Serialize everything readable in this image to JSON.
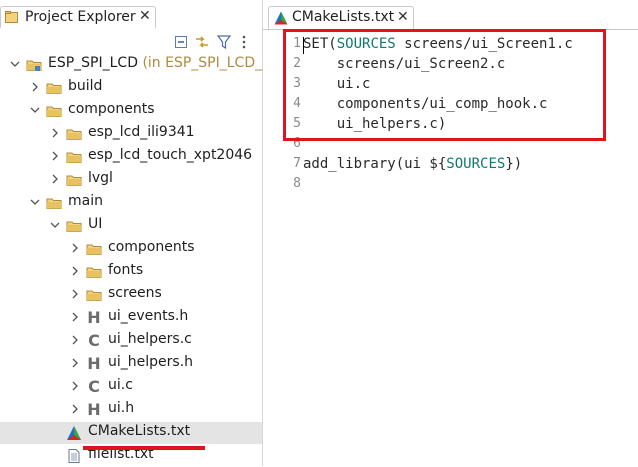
{
  "explorer": {
    "tab_label": "Project Explorer",
    "close_glyph": "✕",
    "toolbar": [
      "collapse-all-icon",
      "link-with-editor-icon",
      "filter-icon",
      "view-menu-icon"
    ],
    "tree": [
      {
        "label": "ESP_SPI_LCD",
        "extra": " (in ESP_SPI_LCD_PA",
        "icon": "project-folder-icon",
        "expanded": true
      },
      {
        "label": "build",
        "icon": "folder-icon",
        "expanded": false
      },
      {
        "label": "components",
        "icon": "folder-icon",
        "expanded": true
      },
      {
        "label": "esp_lcd_ili9341",
        "icon": "folder-icon",
        "expanded": false
      },
      {
        "label": "esp_lcd_touch_xpt2046",
        "icon": "folder-icon",
        "expanded": false
      },
      {
        "label": "lvgl",
        "icon": "folder-icon",
        "expanded": false
      },
      {
        "label": "main",
        "icon": "folder-icon",
        "expanded": true
      },
      {
        "label": "UI",
        "icon": "folder-icon",
        "expanded": true
      },
      {
        "label": "components",
        "icon": "folder-icon",
        "expanded": false
      },
      {
        "label": "fonts",
        "icon": "folder-icon",
        "expanded": false
      },
      {
        "label": "screens",
        "icon": "folder-icon",
        "expanded": false
      },
      {
        "label": "ui_events.h",
        "icon": "h-file-icon",
        "letter": "H"
      },
      {
        "label": "ui_helpers.c",
        "icon": "c-file-icon",
        "letter": "C"
      },
      {
        "label": "ui_helpers.h",
        "icon": "h-file-icon",
        "letter": "H"
      },
      {
        "label": "ui.c",
        "icon": "c-file-icon",
        "letter": "C"
      },
      {
        "label": "ui.h",
        "icon": "h-file-icon",
        "letter": "H"
      },
      {
        "label": "CMakeLists.txt",
        "icon": "cmake-icon",
        "selected": true
      },
      {
        "label": "filelist.txt",
        "icon": "text-file-icon"
      }
    ]
  },
  "editor": {
    "tab_label": "CMakeLists.txt",
    "close_glyph": "✕",
    "lines": [
      {
        "num": "1",
        "parts": [
          [
            "SET",
            "kw"
          ],
          [
            "(",
            "plain"
          ],
          [
            "SOURCES",
            "var"
          ],
          [
            " screens/ui_Screen1.c",
            "plain"
          ]
        ]
      },
      {
        "num": "2",
        "parts": [
          [
            "    screens/ui_Screen2.c",
            "plain"
          ]
        ]
      },
      {
        "num": "3",
        "parts": [
          [
            "    ui.c",
            "plain"
          ]
        ]
      },
      {
        "num": "4",
        "parts": [
          [
            "    components/ui_comp_hook.c",
            "plain"
          ]
        ]
      },
      {
        "num": "5",
        "parts": [
          [
            "    ui_helpers.c)",
            "plain"
          ]
        ]
      },
      {
        "num": "6",
        "parts": []
      },
      {
        "num": "7",
        "parts": [
          [
            "add_library(ui ${",
            "plain"
          ],
          [
            "SOURCES",
            "var"
          ],
          [
            "})",
            "plain"
          ]
        ]
      },
      {
        "num": "8",
        "parts": []
      }
    ]
  },
  "colors": {
    "highlight_red": "#e0141e",
    "folder_yellow": "#e8c260",
    "syntax_teal": "#0e7a6e"
  }
}
